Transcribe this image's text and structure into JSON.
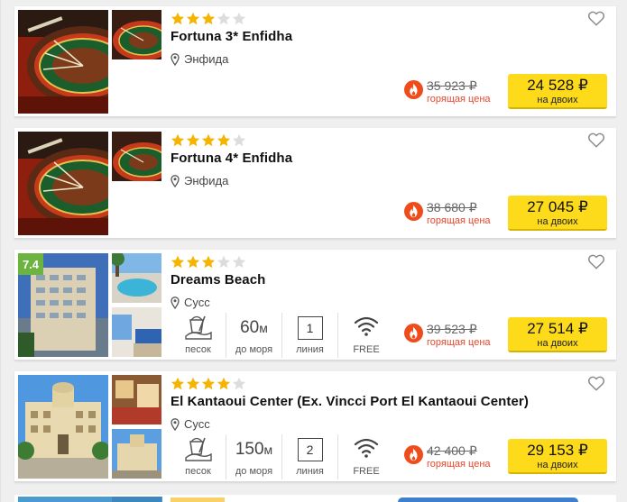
{
  "hotels": [
    {
      "stars": 3,
      "name": "Fortuna 3* Enfidha",
      "location": "Энфида",
      "old_price": "35 923 ₽",
      "hot_label": "горящая цена",
      "price": "24 528 ₽",
      "price_sub": "на двоих",
      "photo": "roulette",
      "badge": null,
      "features": null
    },
    {
      "stars": 4,
      "name": "Fortuna 4* Enfidha",
      "location": "Энфида",
      "old_price": "38 680 ₽",
      "hot_label": "горящая цена",
      "price": "27 045 ₽",
      "price_sub": "на двоих",
      "photo": "roulette",
      "badge": null,
      "features": null
    },
    {
      "stars": 3,
      "name": "Dreams Beach",
      "location": "Сусс",
      "old_price": "39 523 ₽",
      "hot_label": "горящая цена",
      "price": "27 514 ₽",
      "price_sub": "на двоих",
      "photo": "building",
      "badge": "7.4",
      "features": {
        "beach": "песок",
        "distance_num": "60",
        "distance_unit": "м",
        "distance_label": "до моря",
        "line_num": "1",
        "line_label": "линия",
        "wifi": "FREE"
      }
    },
    {
      "stars": 4,
      "name": "El Kantaoui Center (Ex. Vincci Port El Kantaoui Center)",
      "location": "Сусс",
      "old_price": "42 400 ₽",
      "hot_label": "горящая цена",
      "price": "29 153 ₽",
      "price_sub": "на двоих",
      "photo": "resort",
      "badge": null,
      "features": {
        "beach": "песок",
        "distance_num": "150",
        "distance_unit": "м",
        "distance_label": "до моря",
        "line_num": "2",
        "line_label": "линия",
        "wifi": "FREE"
      }
    }
  ],
  "icons": {
    "favorite": "heart-outline-icon",
    "location": "map-pin-icon",
    "hot": "fire-icon",
    "beach": "sand-bucket-icon",
    "wifi": "wifi-icon"
  },
  "colors": {
    "star": "#f4b400",
    "star_empty": "#dddddd",
    "price_button": "#fddb1a",
    "hot": "#e8472c",
    "rating": "#6db33f"
  }
}
